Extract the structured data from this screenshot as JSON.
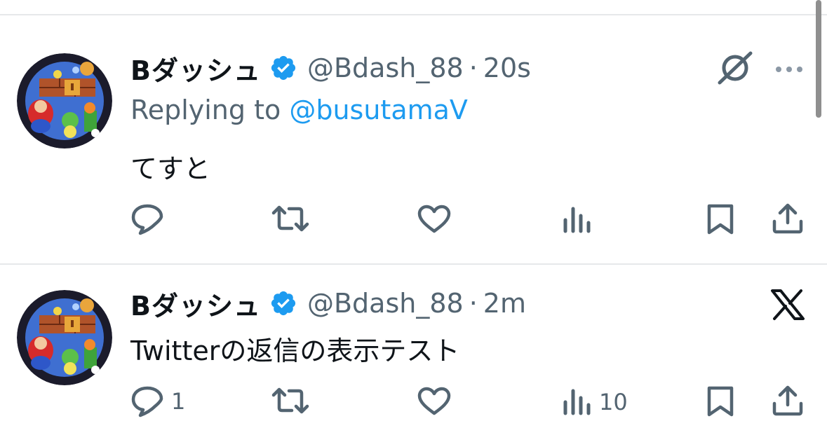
{
  "tweets": [
    {
      "author_name": "Bダッシュ",
      "handle": "@Bdash_88",
      "separator": "·",
      "time": "20s",
      "replying_prefix": "Replying to",
      "replying_handle": "@busutamaV",
      "text": "てすと",
      "reply_count": "",
      "views_count": "",
      "top_right_icon": "grok-icon",
      "has_more_menu": true
    },
    {
      "author_name": "Bダッシュ",
      "handle": "@Bdash_88",
      "separator": "·",
      "time": "2m",
      "text": "Twitterの返信の表示テスト",
      "reply_count": "1",
      "views_count": "10",
      "top_right_icon": "x-logo-icon",
      "has_more_menu": false
    }
  ],
  "colors": {
    "primary_text": "#0f1419",
    "secondary_text": "#536471",
    "link": "#1d9bf0",
    "verified_badge": "#1d9bf0",
    "divider": "#e6e8ea"
  }
}
